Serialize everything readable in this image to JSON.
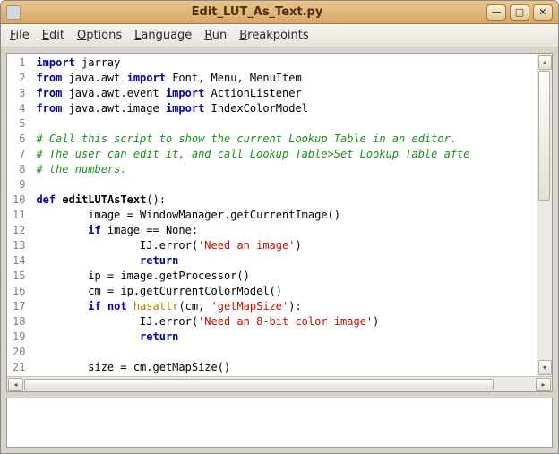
{
  "window": {
    "title": "Edit_LUT_As_Text.py"
  },
  "menu": {
    "file": "File",
    "edit": "Edit",
    "options": "Options",
    "language": "Language",
    "run": "Run",
    "breakpoints": "Breakpoints"
  },
  "code": {
    "lines": [
      [
        {
          "cls": "kw",
          "t": "import"
        },
        {
          "cls": "",
          "t": " jarray"
        }
      ],
      [
        {
          "cls": "kw",
          "t": "from"
        },
        {
          "cls": "",
          "t": " java.awt "
        },
        {
          "cls": "kw",
          "t": "import"
        },
        {
          "cls": "",
          "t": " Font, Menu, MenuItem"
        }
      ],
      [
        {
          "cls": "kw",
          "t": "from"
        },
        {
          "cls": "",
          "t": " java.awt.event "
        },
        {
          "cls": "kw",
          "t": "import"
        },
        {
          "cls": "",
          "t": " ActionListener"
        }
      ],
      [
        {
          "cls": "kw",
          "t": "from"
        },
        {
          "cls": "",
          "t": " java.awt.image "
        },
        {
          "cls": "kw",
          "t": "import"
        },
        {
          "cls": "",
          "t": " IndexColorModel"
        }
      ],
      [
        {
          "cls": "",
          "t": ""
        }
      ],
      [
        {
          "cls": "cm",
          "t": "# Call this script to show the current Lookup Table in an editor."
        }
      ],
      [
        {
          "cls": "cm",
          "t": "# The user can edit it, and call Lookup Table>Set Lookup Table afte"
        }
      ],
      [
        {
          "cls": "cm",
          "t": "# the numbers."
        }
      ],
      [
        {
          "cls": "",
          "t": ""
        }
      ],
      [
        {
          "cls": "kw",
          "t": "def"
        },
        {
          "cls": "",
          "t": " "
        },
        {
          "cls": "fn",
          "t": "editLUTAsText"
        },
        {
          "cls": "",
          "t": "():"
        }
      ],
      [
        {
          "cls": "",
          "t": "        image = WindowManager.getCurrentImage()"
        }
      ],
      [
        {
          "cls": "",
          "t": "        "
        },
        {
          "cls": "kw",
          "t": "if"
        },
        {
          "cls": "",
          "t": " image == None:"
        }
      ],
      [
        {
          "cls": "",
          "t": "                IJ.error("
        },
        {
          "cls": "str",
          "t": "'Need an image'"
        },
        {
          "cls": "",
          "t": ")"
        }
      ],
      [
        {
          "cls": "",
          "t": "                "
        },
        {
          "cls": "kw",
          "t": "return"
        }
      ],
      [
        {
          "cls": "",
          "t": "        ip = image.getProcessor()"
        }
      ],
      [
        {
          "cls": "",
          "t": "        cm = ip.getCurrentColorModel()"
        }
      ],
      [
        {
          "cls": "",
          "t": "        "
        },
        {
          "cls": "kw",
          "t": "if"
        },
        {
          "cls": "",
          "t": " "
        },
        {
          "cls": "kw",
          "t": "not"
        },
        {
          "cls": "",
          "t": " "
        },
        {
          "cls": "builtin",
          "t": "hasattr"
        },
        {
          "cls": "",
          "t": "(cm, "
        },
        {
          "cls": "str",
          "t": "'getMapSize'"
        },
        {
          "cls": "",
          "t": "):"
        }
      ],
      [
        {
          "cls": "",
          "t": "                IJ.error("
        },
        {
          "cls": "str",
          "t": "'Need an 8-bit color image'"
        },
        {
          "cls": "",
          "t": ")"
        }
      ],
      [
        {
          "cls": "",
          "t": "                "
        },
        {
          "cls": "kw",
          "t": "return"
        }
      ],
      [
        {
          "cls": "",
          "t": ""
        }
      ],
      [
        {
          "cls": "",
          "t": "        size = cm.getMapSize()"
        }
      ]
    ]
  },
  "glyphs": {
    "min": "—",
    "max": "□",
    "close": "✕",
    "left": "◂",
    "right": "▸",
    "up": "▴",
    "down": "▾"
  }
}
